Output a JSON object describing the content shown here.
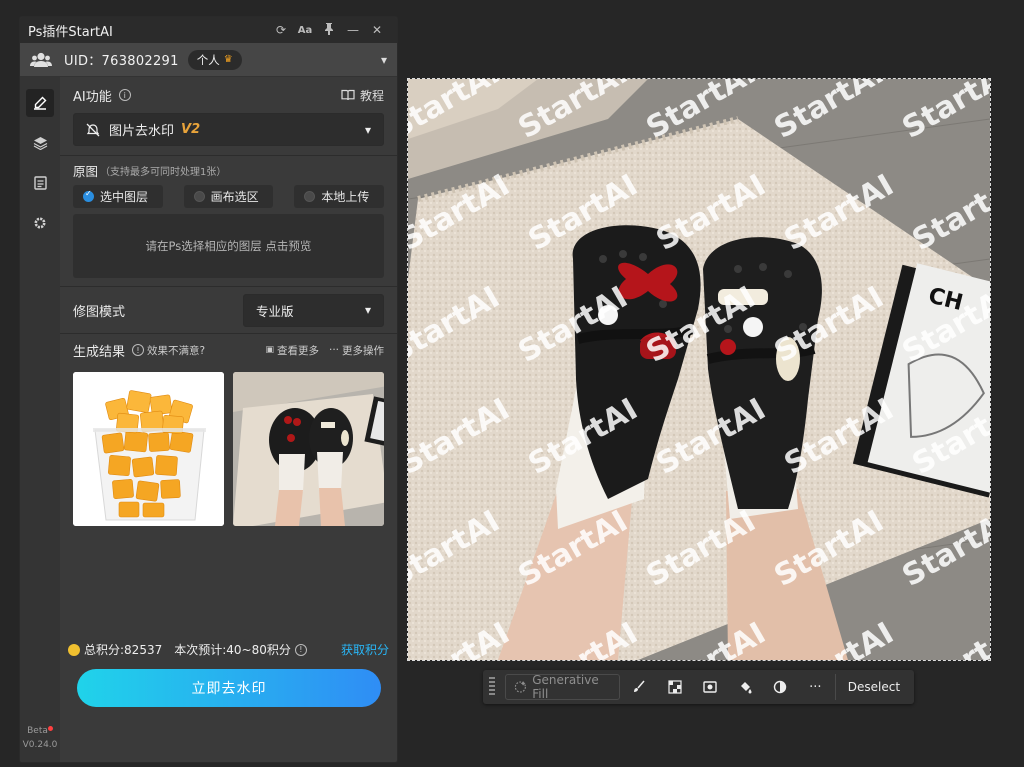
{
  "plugin": {
    "title": "Ps插件StartAI",
    "titlebar_buttons": [
      "refresh-icon",
      "font-size-icon",
      "pin-icon",
      "minimize-icon",
      "close-icon"
    ],
    "uid_label": "UID：763802291",
    "plan_badge": "个人",
    "nav_icons": [
      "brush-icon",
      "layers-icon",
      "save-icon",
      "settings-icon"
    ],
    "beta_label": "Beta",
    "version": "V0.24.0"
  },
  "ai_function": {
    "label": "AI功能",
    "tutorial": "教程",
    "selected": "图片去水印",
    "selected_version": "V2"
  },
  "source": {
    "label": "原图",
    "hint": "（支持最多可同时处理1张）",
    "options": [
      "选中图层",
      "画布选区",
      "本地上传"
    ],
    "selected_index": 0,
    "dropzone_text": "请在Ps选择相应的图层 点击预览"
  },
  "mode": {
    "label": "修图模式",
    "value": "专业版"
  },
  "results": {
    "label": "生成结果",
    "unsatisfied": "效果不满意?",
    "view_more": "查看更多",
    "more_actions": "更多操作"
  },
  "footer": {
    "total_points": "总积分:82537",
    "estimate": "本次预计:40~80积分",
    "get_points": "获取积分",
    "primary_button": "立即去水印"
  },
  "canvas": {
    "watermark_text": "StartAI",
    "book_text": "CH"
  },
  "taskbar": {
    "generative_fill": "Generative Fill",
    "tools": [
      "brush-icon",
      "mask-icon",
      "frame-icon",
      "fill-icon",
      "adjust-icon",
      "more-icon"
    ],
    "deselect": "Deselect"
  },
  "colors": {
    "accent_blue": "#29b6f6",
    "button_gradient_start": "#20d3ea",
    "button_gradient_end": "#2f8df5",
    "version_gold": "#e8a33a"
  }
}
